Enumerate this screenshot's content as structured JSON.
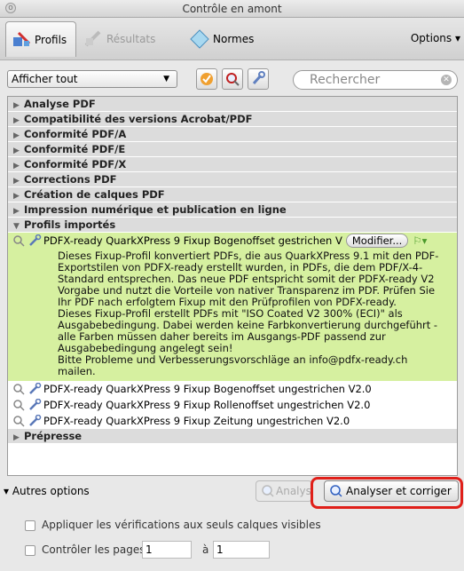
{
  "window": {
    "title": "Contrôle en amont"
  },
  "tabs": [
    {
      "label": "Profils",
      "icon": "profiles-icon"
    },
    {
      "label": "Résultats",
      "icon": "results-icon"
    },
    {
      "label": "Normes",
      "icon": "standards-icon"
    }
  ],
  "toolbar": {
    "options_label": "Options"
  },
  "filter": {
    "select_value": "Afficher tout",
    "search_placeholder": "Rechercher"
  },
  "categories": [
    "Analyse PDF",
    "Compatibilité des versions Acrobat/PDF",
    "Conformité PDF/A",
    "Conformité PDF/E",
    "Conformité PDF/X",
    "Corrections PDF",
    "Création de calques PDF",
    "Impression numérique et publication en ligne",
    "Profils importés"
  ],
  "selected_profile": {
    "name": "PDFX-ready QuarkXPress 9 Fixup Bogenoffset gestrichen V",
    "edit_button": "Modifier...",
    "description": "Dieses Fixup-Profil konvertiert PDFs, die aus QuarkXPress 9.1 mit den PDF-\nExportstilen von PDFX-ready erstellt wurden, in PDFs, die dem PDF/X-4-\nStandard entsprechen. Das neue PDF entspricht somit der PDFX-ready V2\nVorgabe und nutzt die Vorteile von nativer Transparenz im PDF. Prüfen Sie\nIhr PDF nach erfolgtem Fixup mit den Prüfprofilen von PDFX-ready.\nDieses Fixup-Profil erstellt PDFs mit \"ISO Coated V2 300% (ECI)\" als\nAusgabebedingung. Dabei werden keine Farbkonvertierung durchgeführt -\nalle Farben müssen daher bereits im Ausgangs-PDF passend zur\nAusgabebedingung angelegt sein!\nBitte Probleme und Verbesserungsvorschläge an info@pdfx-ready.ch\nmailen."
  },
  "profiles": [
    "PDFX-ready QuarkXPress 9 Fixup Bogenoffset ungestrichen V2.0",
    "PDFX-ready QuarkXPress 9 Fixup Rollenoffset ungestrichen V2.0",
    "PDFX-ready QuarkXPress 9 Fixup Zeitung ungestrichen V2.0"
  ],
  "last_category": "Prépresse",
  "bottom": {
    "more_options": "Autres options",
    "analyse_label": "Analyse",
    "analyse_fix_label": "Analyser et corriger",
    "visible_layers_label": "Appliquer les vérifications aux seuls calques visibles",
    "check_pages_label": "Contrôler les pages",
    "page_from": "1",
    "to_label": "à",
    "page_to": "1"
  },
  "colors": {
    "selection": "#d6f0a0",
    "highlight_box": "#e0201a"
  }
}
